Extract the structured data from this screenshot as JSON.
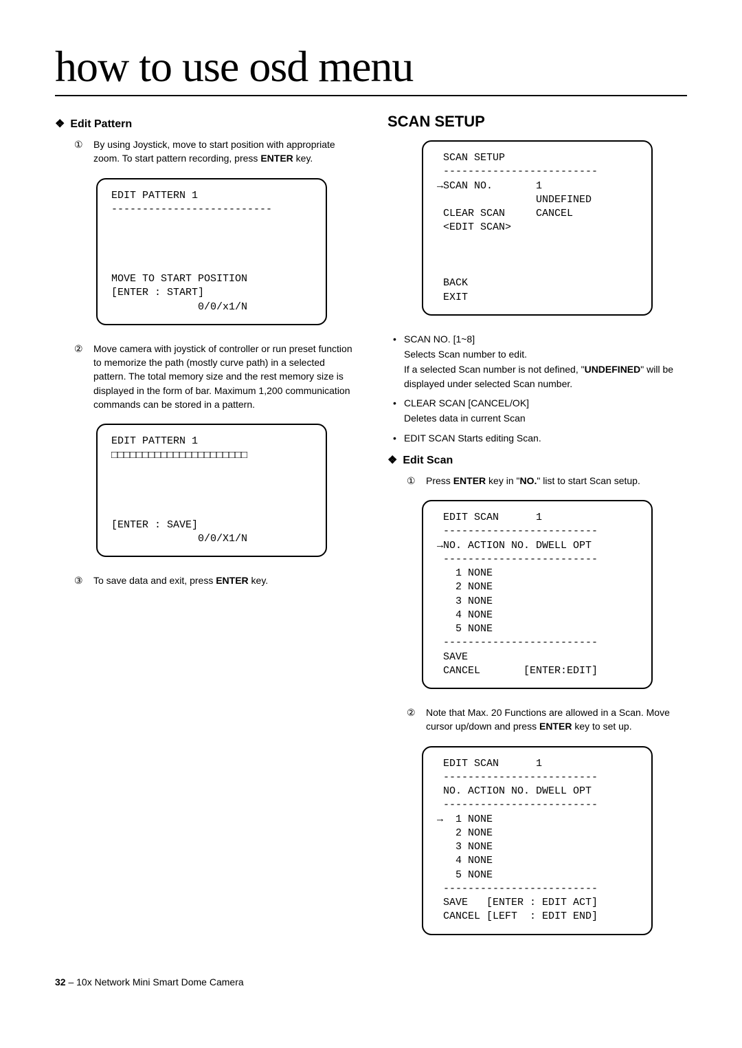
{
  "page_title": "how to use osd menu",
  "left": {
    "edit_pattern_heading": "Edit Pattern",
    "step1": "By using Joystick, move to start position with appropriate zoom. To start pattern recording, press ",
    "step1_bold": "ENTER",
    "step1_end": " key.",
    "osd1_line1": "EDIT PATTERN 1",
    "osd1_line2": "--------------------------",
    "osd1_line3": "MOVE TO START POSITION",
    "osd1_line4": "[ENTER : START]",
    "osd1_line5": "              0/0/x1/N",
    "step2": "Move camera with joystick of controller or run preset function to memorize the path (mostly curve path) in a selected pattern. The total memory size and the rest memory size is displayed in the form of bar. Maximum 1,200 communication commands can be stored in a pattern.",
    "osd2_line1": "EDIT PATTERN 1",
    "osd2_line2": "□□□□□□□□□□□□□□□□□□□□□□",
    "osd2_line3": "[ENTER : SAVE]",
    "osd2_line4": "              0/0/X1/N",
    "step3": "To save data and exit, press ",
    "step3_bold": "ENTER",
    "step3_end": " key."
  },
  "right": {
    "scan_setup_heading": "SCAN SETUP",
    "osd3_line1": " SCAN SETUP",
    "osd3_line2": " -------------------------",
    "osd3_line3": "→SCAN NO.       1",
    "osd3_line4": "                UNDEFINED",
    "osd3_line5": " CLEAR SCAN     CANCEL",
    "osd3_line6": " <EDIT SCAN>",
    "osd3_line7": " BACK",
    "osd3_line8": " EXIT",
    "bullet1_title": "SCAN NO.        [1~8]",
    "bullet1_l1": "Selects Scan number to edit.",
    "bullet1_l2a": "If a selected Scan number is not defined, \"",
    "bullet1_l2b": "UNDEFINED",
    "bullet1_l2c": "\" will be displayed under selected Scan number.",
    "bullet2_title": "CLEAR SCAN    [CANCEL/OK]",
    "bullet2_l1": "Deletes data in current Scan",
    "bullet3_title": "EDIT SCAN       Starts editing Scan.",
    "edit_scan_heading": "Edit Scan",
    "es_step1a": "Press ",
    "es_step1b": "ENTER",
    "es_step1c": " key in \"",
    "es_step1d": "NO.",
    "es_step1e": "\" list to start Scan setup.",
    "osd4_line1": " EDIT SCAN      1",
    "osd4_line2": " -------------------------",
    "osd4_line3": "→NO. ACTION NO. DWELL OPT",
    "osd4_line4": " -------------------------",
    "osd4_line5": "   1 NONE",
    "osd4_line6": "   2 NONE",
    "osd4_line7": "   3 NONE",
    "osd4_line8": "   4 NONE",
    "osd4_line9": "   5 NONE",
    "osd4_line10": " -------------------------",
    "osd4_line11": " SAVE",
    "osd4_line12": " CANCEL       [ENTER:EDIT]",
    "es_step2a": "Note that Max. 20 Functions are allowed in a Scan. Move cursor up/down and press ",
    "es_step2b": "ENTER",
    "es_step2c": " key to set up.",
    "osd5_line1": " EDIT SCAN      1",
    "osd5_line2": " -------------------------",
    "osd5_line3": " NO. ACTION NO. DWELL OPT",
    "osd5_line4": " -------------------------",
    "osd5_line5": "→  1 NONE",
    "osd5_line6": "   2 NONE",
    "osd5_line7": "   3 NONE",
    "osd5_line8": "   4 NONE",
    "osd5_line9": "   5 NONE",
    "osd5_line10": " -------------------------",
    "osd5_line11": " SAVE   [ENTER : EDIT ACT]",
    "osd5_line12": " CANCEL [LEFT  : EDIT END]"
  },
  "footer_num": "32",
  "footer_text": " – 10x Network Mini Smart Dome Camera"
}
